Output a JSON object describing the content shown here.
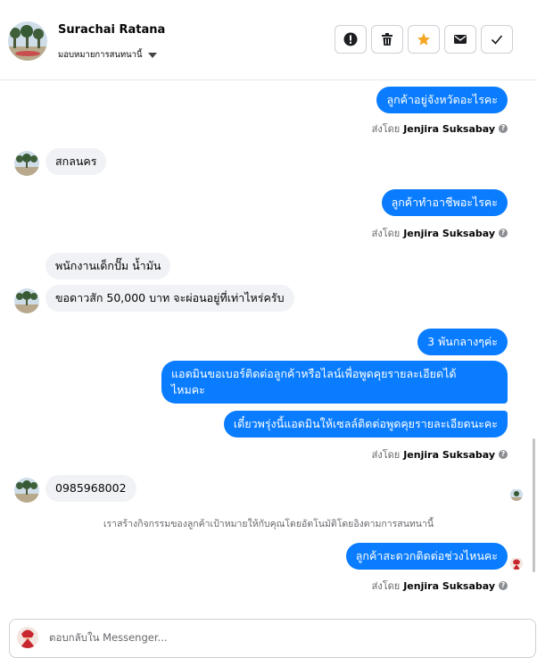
{
  "header": {
    "contact_name": "Surachai Ratana",
    "assign_label": "มอบหมายการสนทนานี้",
    "actions": [
      {
        "icon": "alert-icon",
        "label": "!"
      },
      {
        "icon": "trash-icon",
        "label": ""
      },
      {
        "icon": "star-icon",
        "label": ""
      },
      {
        "icon": "envelope-icon",
        "label": ""
      },
      {
        "icon": "check-icon",
        "label": ""
      }
    ],
    "star_color": "#f5a623"
  },
  "colors": {
    "outgoing": "#0a7cff",
    "incoming": "#f0f2f5"
  },
  "messages": {
    "m1": "ลูกค้าอยู่จังหวัดอะไรคะ",
    "m2": "สกลนคร",
    "m3": "ลูกค้าทำอาชีพอะไรคะ",
    "m4": "พนักงานเด็กปั๊ม น้ำมัน",
    "m5": "ขอดาวสัก 50,000 บาท จะผ่อนอยู่ที่เท่าไหร่ครับ",
    "m6": "3 พันกลางๆค่ะ",
    "m7_line1": "แอดมินขอเบอร์ติดต่อลูกค้าหรือไลน์เพื่อพูดคุยรายละเอียดได้",
    "m7_line2": "ไหมคะ",
    "m8": "เดี๋ยวพรุ่งนี้แอดมินให้เซลล์ติดต่อพูดคุยรายละเอียดนะคะ",
    "m9": "0985968002",
    "m10": "ลูกค้าสะดวกติดต่อช่วงไหนคะ"
  },
  "sent_by": {
    "prefix": "ส่งโดย",
    "name": "Jenjira Suksabay",
    "help": "?"
  },
  "system_note": "เราสร้างกิจกรรมของลูกค้าเป้าหมายให้กับคุณโดยอัตโนมัติโดยอิงตามการสนทนานี้",
  "composer": {
    "placeholder": "ตอบกลับใน Messenger..."
  }
}
